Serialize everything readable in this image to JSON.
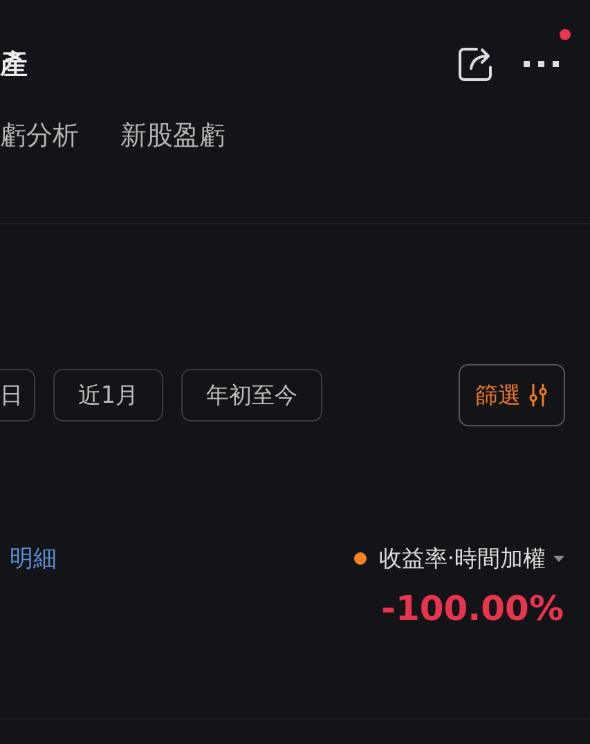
{
  "header": {
    "title": "產",
    "notification": true
  },
  "tabs": [
    {
      "label": "虧分析",
      "selected": false
    },
    {
      "label": "新股盈虧",
      "selected": false
    }
  ],
  "periods": [
    {
      "label": "日",
      "selected": false
    },
    {
      "label": "近1月",
      "selected": false
    },
    {
      "label": "年初至今",
      "selected": false
    }
  ],
  "filter": {
    "label": "篩選"
  },
  "detail_link": "明細",
  "metric": {
    "label": "收益率·時間加權",
    "color": "#f5821f"
  },
  "value": "-100.00%"
}
